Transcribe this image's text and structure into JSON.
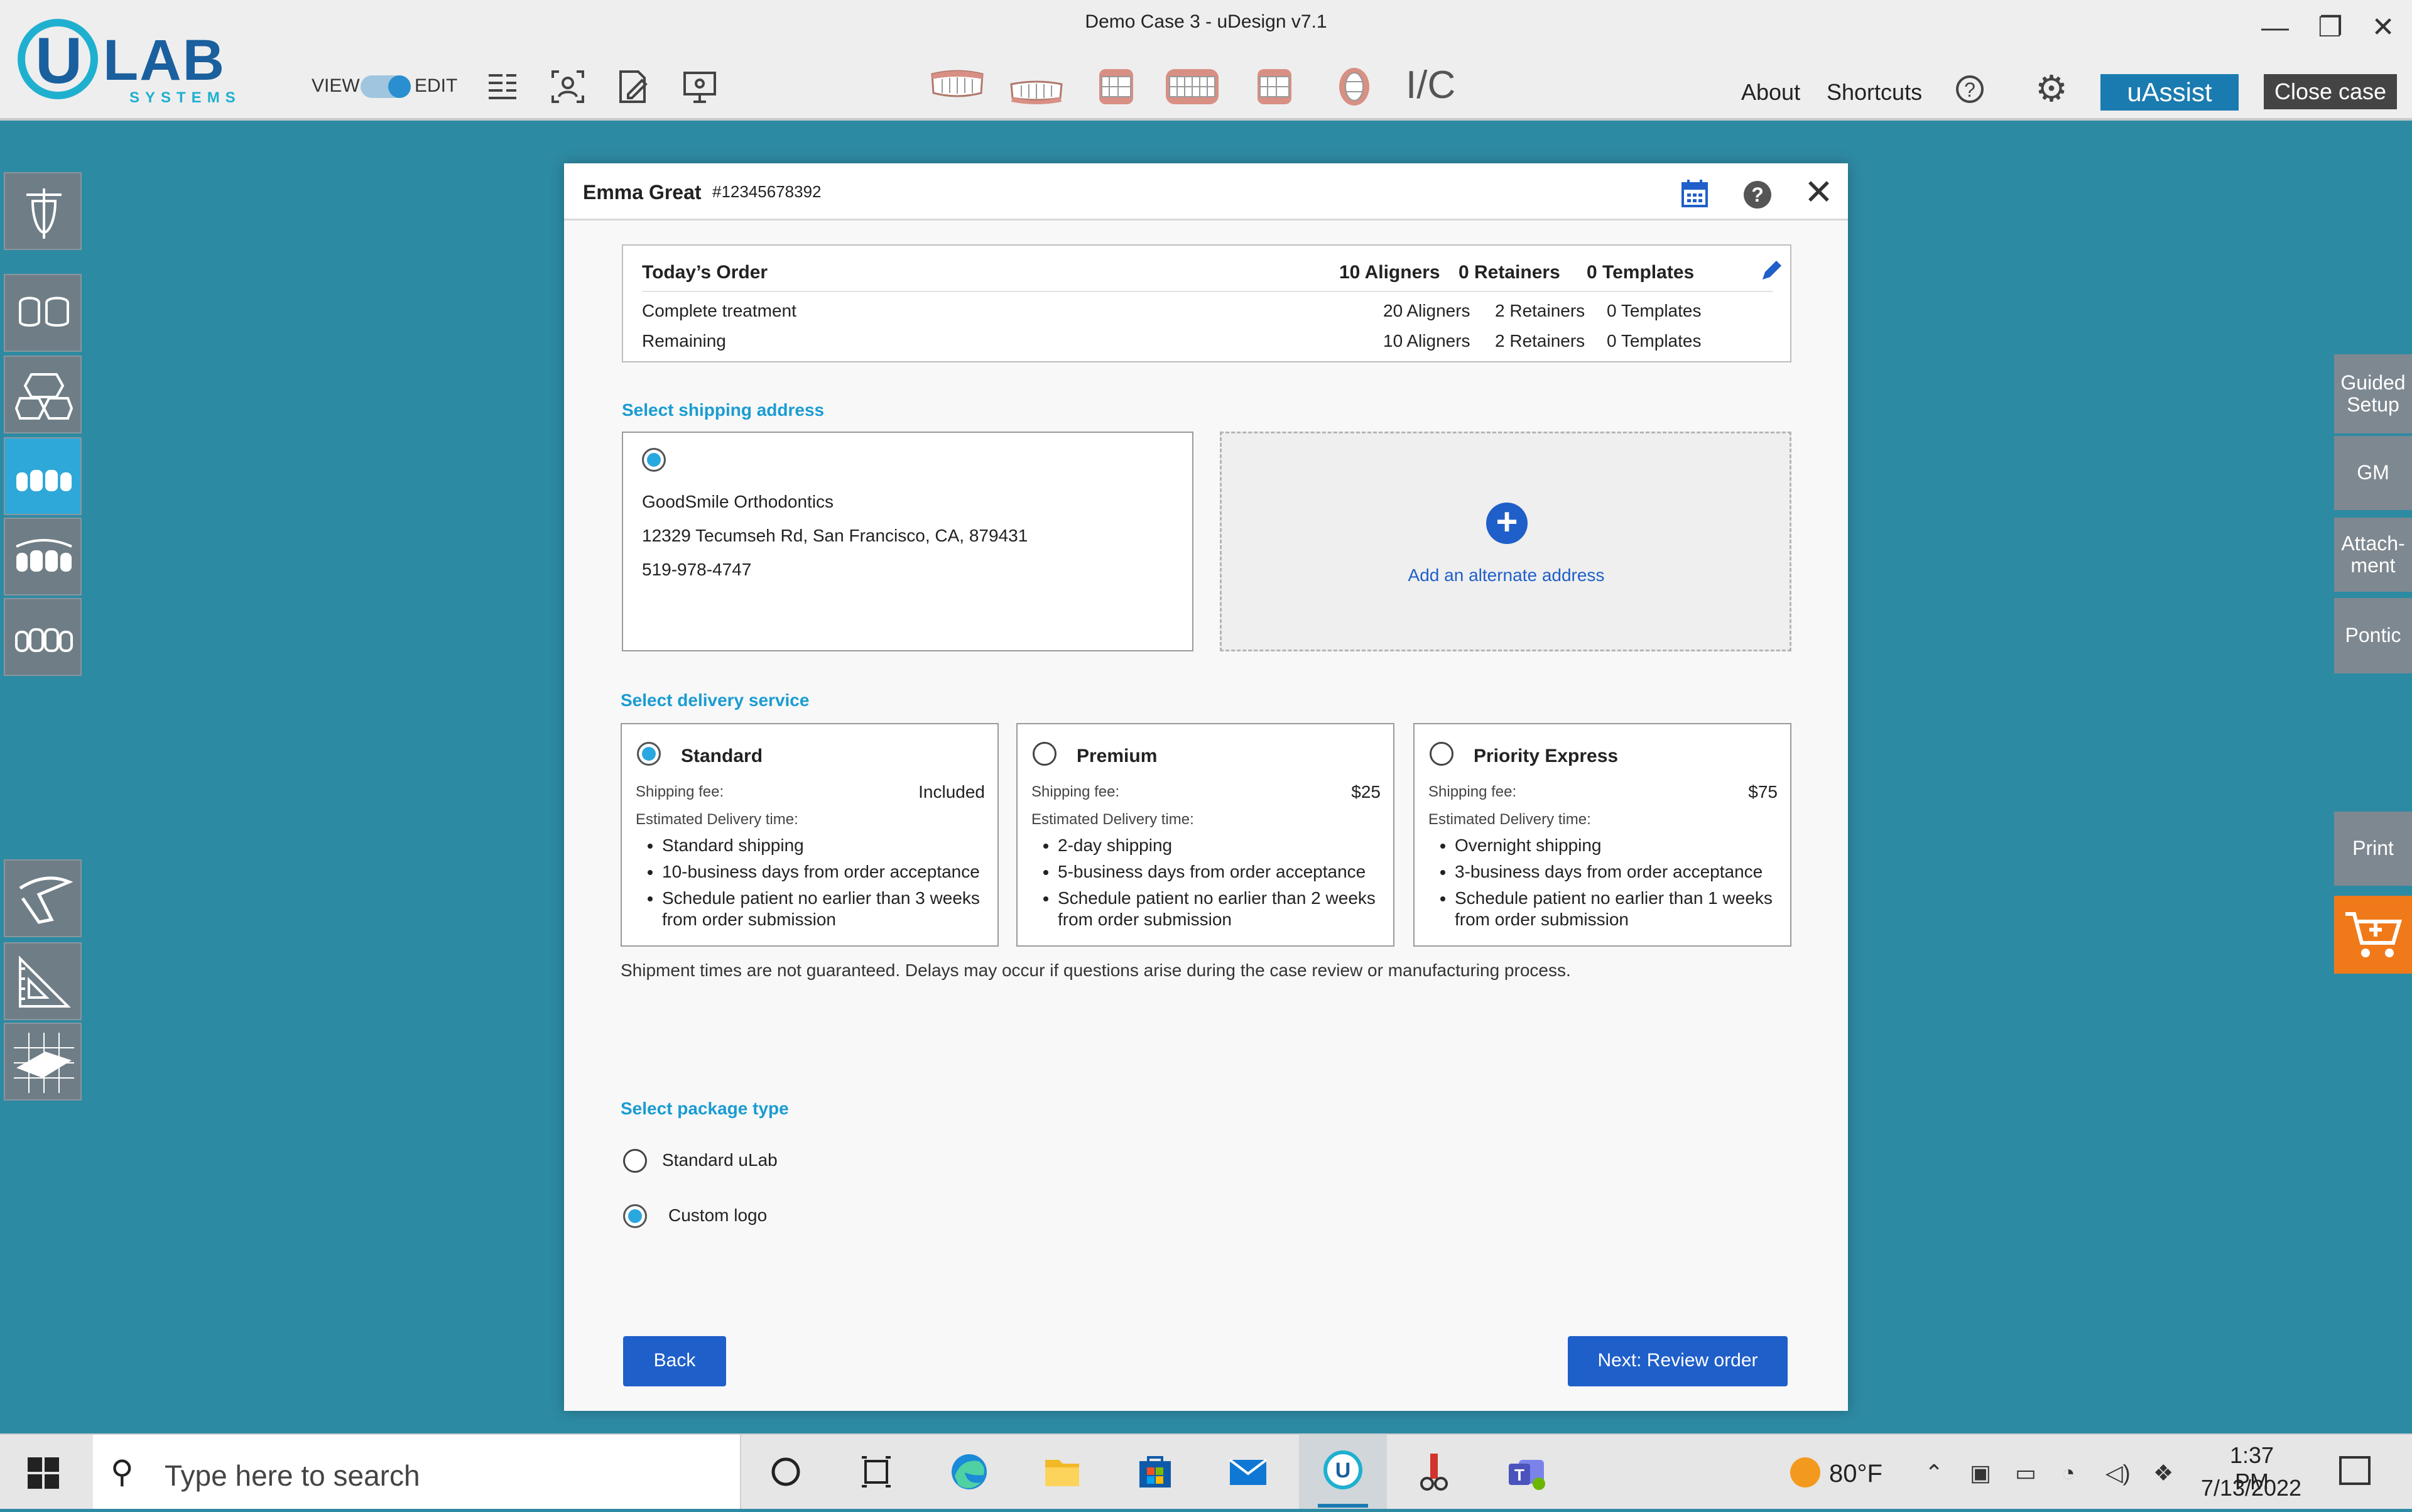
{
  "window": {
    "title": "Demo Case 3 - uDesign v7.1",
    "minimize_glyph": "—",
    "maximize_glyph": "❐",
    "close_glyph": "✕"
  },
  "logo": {
    "u": "U",
    "lab": "LAB",
    "systems": "SYSTEMS"
  },
  "toolbar": {
    "view_label": "VIEW",
    "edit_label": "EDIT",
    "mode": "edit",
    "ic_label": "I/C",
    "about": "About",
    "shortcuts": "Shortcuts",
    "help_glyph": "?",
    "uassist": "uAssist",
    "close_case": "Close case",
    "tool_icons": [
      "records-icon",
      "patient-photo-icon",
      "prescription-icon",
      "presentation-icon"
    ],
    "tooth_views": [
      "upper-arch-front-icon",
      "lower-arch-front-icon",
      "left-side-icon",
      "front-view-icon",
      "right-side-icon",
      "occlusal-view-icon"
    ]
  },
  "left_tools": [
    "tooth-axis-icon",
    "tooth-pair-icon",
    "ipr-icon",
    "upper-arch-icon",
    "both-arches-icon",
    "tooth-row-icon",
    "cephalometric-icon",
    "ruler-icon",
    "grid-plane-icon"
  ],
  "right_tools": {
    "guided_setup": "Guided\nSetup",
    "gm": "GM",
    "attachment": "Attach-\nment",
    "pontic": "Pontic",
    "print": "Print",
    "cart_icon": "cart-icon"
  },
  "dialog": {
    "patient_name": "Emma Great",
    "patient_id": "#12345678392",
    "help_glyph": "?",
    "close_glyph": "✕",
    "order": {
      "title": "Today’s Order",
      "aligners": "10 Aligners",
      "retainers": "0 Retainers",
      "templates": "0 Templates",
      "rows": [
        {
          "label": "Complete treatment",
          "aligners": "20 Aligners",
          "retainers": "2 Retainers",
          "templates": "0 Templates"
        },
        {
          "label": "Remaining",
          "aligners": "10 Aligners",
          "retainers": "2 Retainers",
          "templates": "0 Templates"
        }
      ]
    },
    "shipping_heading": "Select shipping address",
    "address": {
      "selected": true,
      "name": "GoodSmile Orthodontics",
      "street": "12329 Tecumseh Rd, San Francisco, CA, 879431",
      "phone": "519-978-4747"
    },
    "add_address_label": "Add an alternate address",
    "delivery_heading": "Select delivery service",
    "delivery_options": [
      {
        "name": "Standard",
        "selected": true,
        "fee_label": "Shipping fee:",
        "fee": "Included",
        "edt_label": "Estimated Delivery time:",
        "bullets": [
          "Standard shipping",
          "10-business days from order acceptance",
          "Schedule patient no earlier than 3 weeks from order submission"
        ]
      },
      {
        "name": "Premium",
        "selected": false,
        "fee_label": "Shipping fee:",
        "fee": "$25",
        "edt_label": "Estimated Delivery time:",
        "bullets": [
          "2-day shipping",
          "5-business days from order acceptance",
          "Schedule patient no earlier than 2 weeks from order submission"
        ]
      },
      {
        "name": "Priority Express",
        "selected": false,
        "fee_label": "Shipping fee:",
        "fee": "$75",
        "edt_label": "Estimated Delivery time:",
        "bullets": [
          "Overnight shipping",
          "3-business days from order acceptance",
          "Schedule patient no earlier than 1 weeks from order submission"
        ]
      }
    ],
    "shipment_note": "Shipment times are not guaranteed. Delays may occur if questions arise during the case review or manufacturing process.",
    "package_heading": "Select package type",
    "package_options": [
      {
        "label": "Standard uLab",
        "selected": false
      },
      {
        "label": "Custom logo",
        "selected": true
      }
    ],
    "back_label": "Back",
    "next_label": "Next: Review order"
  },
  "taskbar": {
    "search_placeholder": "Type here to search",
    "apps": [
      "cortana-icon",
      "task-view-icon",
      "edge-icon",
      "file-explorer-icon",
      "store-icon",
      "mail-icon",
      "udesign-icon",
      "snipping-tool-icon",
      "teams-icon"
    ],
    "weather": "80°F",
    "time": "1:37 PM",
    "date": "7/13/2022"
  },
  "colors": {
    "accent": "#1a9cd2",
    "primary_button": "#1f5fc9",
    "uassist": "#1a7bb0",
    "cart": "#f07a1a",
    "desktop": "#2d8aa3"
  }
}
